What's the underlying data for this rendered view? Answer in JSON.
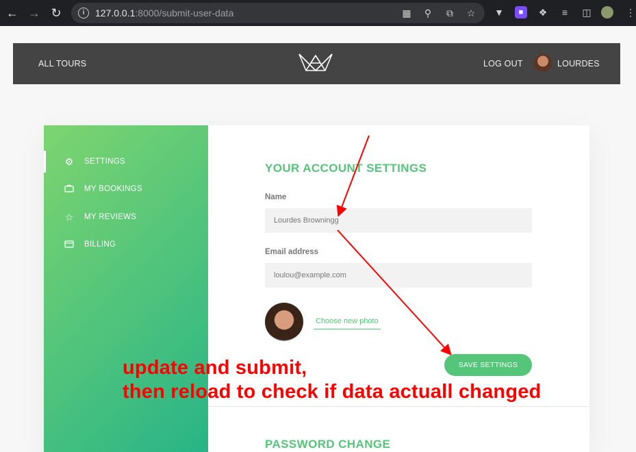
{
  "browser": {
    "url_host": "127.0.0.1",
    "url_path": ":8000/submit-user-data"
  },
  "header": {
    "all_tours": "ALL TOURS",
    "log_out": "LOG OUT",
    "user_name": "LOURDES"
  },
  "sidebar": {
    "items": [
      {
        "label": "SETTINGS",
        "icon": "gear-icon"
      },
      {
        "label": "MY BOOKINGS",
        "icon": "briefcase-icon"
      },
      {
        "label": "MY REVIEWS",
        "icon": "star-icon"
      },
      {
        "label": "BILLING",
        "icon": "credit-card-icon"
      }
    ]
  },
  "account": {
    "title": "YOUR ACCOUNT SETTINGS",
    "name_label": "Name",
    "name_value": "Lourdes Browningg",
    "email_label": "Email address",
    "email_value": "loulou@example.com",
    "photo_link": "Choose new photo",
    "save_label": "SAVE SETTINGS"
  },
  "password": {
    "title": "PASSWORD CHANGE"
  },
  "annotation": {
    "line1": "update and submit,",
    "line2": "then reload to check if data actuall changed",
    "color": "#ff0000"
  },
  "colors": {
    "accent": "#55c57a",
    "header_bg": "#444444"
  }
}
